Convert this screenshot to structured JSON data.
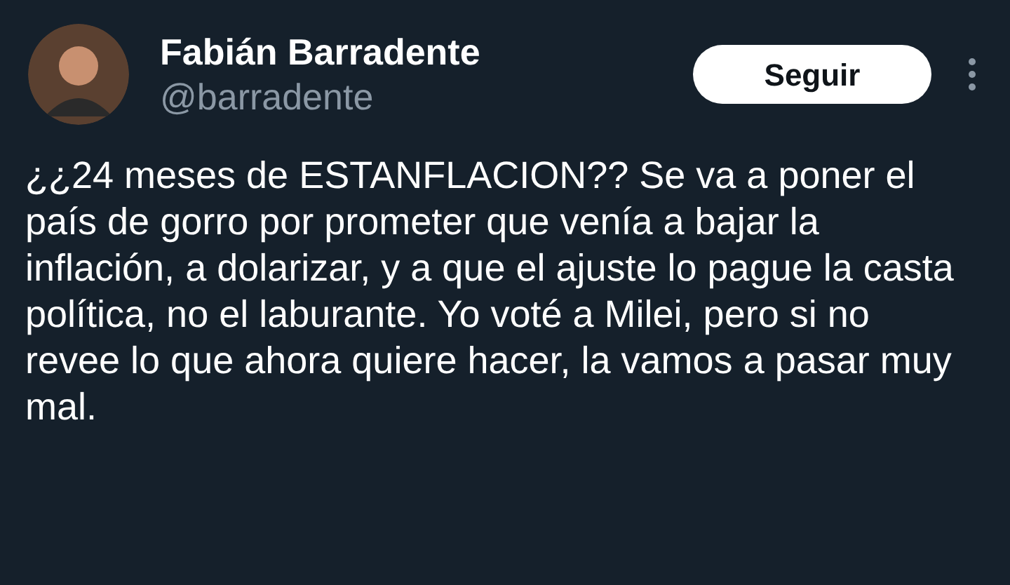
{
  "author": {
    "name": "Fabián Barradente",
    "handle": "@barradente"
  },
  "follow_button": {
    "label": "Seguir"
  },
  "tweet": {
    "text": "¿¿24 meses de ESTANFLACION?? Se va a poner el país de gorro por prometer que venía a bajar la inflación, a dolarizar, y a que el ajuste lo pague la casta política, no el laburante. Yo voté a Milei, pero si no revee lo que ahora quiere hacer, la vamos a pasar muy mal."
  }
}
